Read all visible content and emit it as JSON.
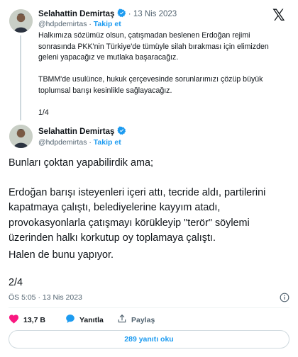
{
  "tweet1": {
    "author_name": "Selahattin Demirtaş",
    "separator": "·",
    "date": "13 Nis 2023",
    "handle": "@hdpdemirtas",
    "follow_label": "Takip et",
    "text_p1": "Halkımıza sözümüz olsun, çatışmadan beslenen Erdoğan rejimi\nsonrasında PKK'nin Türkiye'de tümüyle silah bırakması için elimizden\ngeleni yapacağız ve mutlaka başaracağız.",
    "text_p2": "TBMM'de usulünce, hukuk çerçevesinde sorunlarımızı çözüp büyük\ntoplumsal barışı kesinlikle sağlayacağız.",
    "counter": "1/4"
  },
  "tweet2": {
    "author_name": "Selahattin Demirtaş",
    "handle": "@hdpdemirtas",
    "follow_label": "Takip et",
    "text_p1": "Bunları çoktan yapabilirdik ama;",
    "text_p2": "Erdoğan barışı isteyenleri içeri attı, tecride aldı, partilerini\nkapatmaya çalıştı, belediyelerine kayyım atadı,\nprovokasyonlarla çatışmayı körükleyip \"terör\" söylemi\nüzerinden halkı korkutup oy toplamaya çalıştı.",
    "text_p3": "Halen de bunu yapıyor.",
    "counter": "2/4",
    "timestamp": "ÖS 5:05 · 13 Nis 2023"
  },
  "actions": {
    "like_count": "13,7 B",
    "reply_label": "Yanıtla",
    "share_label": "Paylaş"
  },
  "read_replies_label": "289 yanıtı oku",
  "icons": {
    "verified": "verified-badge-icon",
    "x_logo": "x-logo-icon",
    "info": "info-icon",
    "like": "heart-icon",
    "reply": "reply-bubble-icon",
    "share": "share-icon"
  },
  "colors": {
    "accent": "#1d9bf0",
    "like": "#f91880",
    "muted": "#536471",
    "text": "#0f1419"
  }
}
